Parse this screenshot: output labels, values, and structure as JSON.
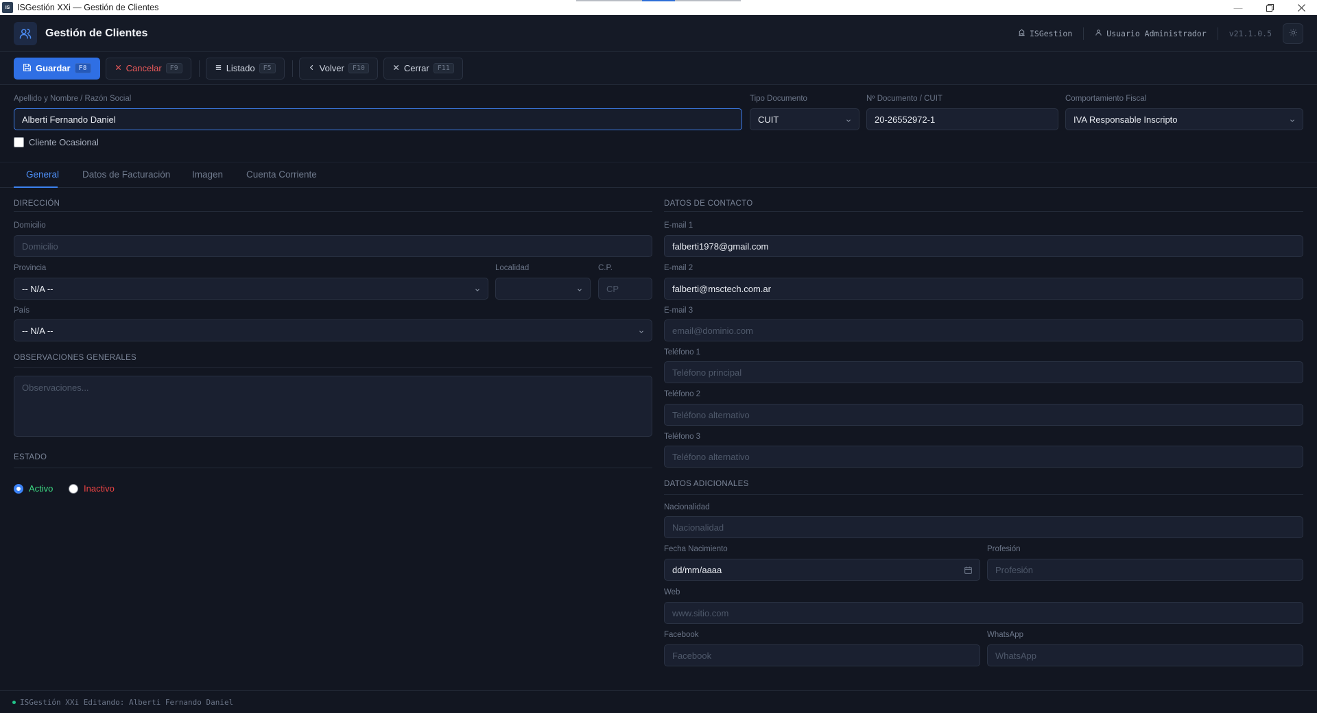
{
  "window": {
    "title": "ISGestión XXi — Gestión de Clientes",
    "icon_text": "IS",
    "controls": [
      "minimize-icon",
      "restore-icon",
      "close-icon"
    ]
  },
  "header": {
    "title": "Gestión de Clientes",
    "company": "ISGestion",
    "user": "Usuario Administrador",
    "version": "v21.1.0.5"
  },
  "toolbar": {
    "save": {
      "label": "Guardar",
      "key": "F8"
    },
    "cancel": {
      "label": "Cancelar",
      "key": "F9"
    },
    "list": {
      "label": "Listado",
      "key": "F5"
    },
    "back": {
      "label": "Volver",
      "key": "F10"
    },
    "close": {
      "label": "Cerrar",
      "key": "F11"
    }
  },
  "client": {
    "name_label": "Apellido y Nombre / Razón Social",
    "name_value": "Alberti Fernando Daniel",
    "doc_type_label": "Tipo Documento",
    "doc_type_value": "CUIT",
    "doc_number_label": "Nº Documento / CUIT",
    "doc_number_value": "20-26552972-1",
    "fiscal_label": "Comportamiento Fiscal",
    "fiscal_value": "IVA Responsable Inscripto",
    "occasional_label": "Cliente Ocasional",
    "occasional_checked": false
  },
  "tabs": [
    {
      "label": "General",
      "active": true
    },
    {
      "label": "Datos de Facturación",
      "active": false
    },
    {
      "label": "Imagen",
      "active": false
    },
    {
      "label": "Cuenta Corriente",
      "active": false
    }
  ],
  "address": {
    "section": "DIRECCIÓN",
    "street_label": "Domicilio",
    "street_placeholder": "Domicilio",
    "province_label": "Provincia",
    "province_value": "-- N/A --",
    "city_label": "Localidad",
    "city_value": "",
    "zip_label": "C.P.",
    "zip_placeholder": "CP",
    "country_label": "País",
    "country_value": "-- N/A --"
  },
  "notes": {
    "section": "OBSERVACIONES GENERALES",
    "placeholder": "Observaciones..."
  },
  "status": {
    "section": "ESTADO",
    "active_label": "Activo",
    "inactive_label": "Inactivo",
    "selected": "Activo",
    "active_color": "#3ddc84",
    "inactive_color": "#ef4444"
  },
  "contact": {
    "section": "DATOS DE CONTACTO",
    "email1_label": "E-mail 1",
    "email1_value": "falberti1978@gmail.com",
    "email2_label": "E-mail 2",
    "email2_value": "falberti@msctech.com.ar",
    "email3_label": "E-mail 3",
    "email3_placeholder": "email@dominio.com",
    "phone1_label": "Teléfono 1",
    "phone1_placeholder": "Teléfono principal",
    "phone2_label": "Teléfono 2",
    "phone2_placeholder": "Teléfono alternativo",
    "phone3_label": "Teléfono 3",
    "phone3_placeholder": "Teléfono alternativo"
  },
  "additional": {
    "section": "DATOS ADICIONALES",
    "nationality_label": "Nacionalidad",
    "nationality_placeholder": "Nacionalidad",
    "birth_label": "Fecha Nacimiento",
    "birth_value": "dd/mm/aaaa",
    "profession_label": "Profesión",
    "profession_placeholder": "Profesión",
    "web_label": "Web",
    "web_placeholder": "www.sitio.com",
    "facebook_label": "Facebook",
    "facebook_placeholder": "Facebook",
    "whatsapp_label": "WhatsApp",
    "whatsapp_placeholder": "WhatsApp"
  },
  "statusbar": {
    "text": "ISGestión XXi Editando: Alberti Fernando Daniel"
  },
  "colors": {
    "accent": "#2f6fe4",
    "background": "#121621",
    "input_bg": "#1a2030"
  }
}
